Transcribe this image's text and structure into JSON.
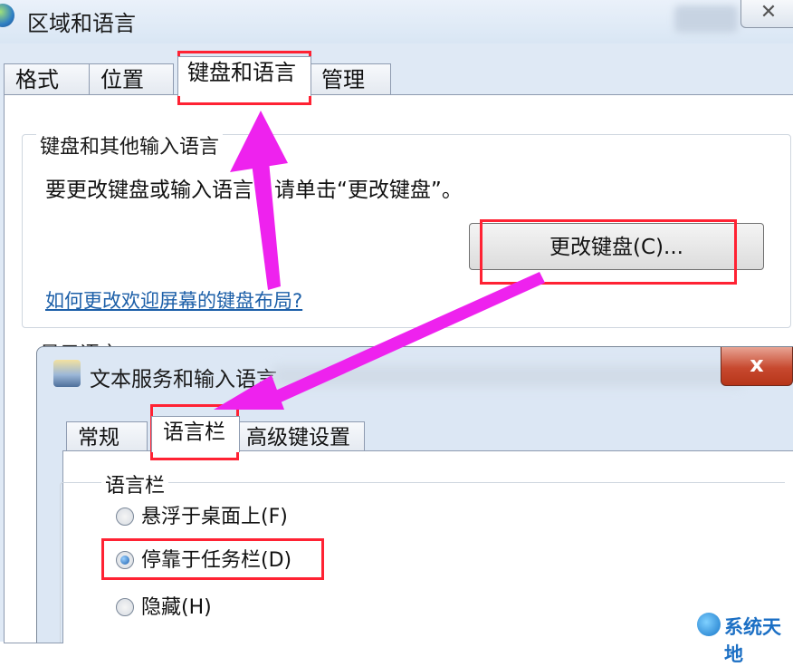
{
  "region_window": {
    "title": "区域和语言",
    "close_label": "✕",
    "tabs": [
      {
        "label": "格式"
      },
      {
        "label": "位置"
      },
      {
        "label": "键盘和语言"
      },
      {
        "label": "管理"
      }
    ],
    "active_tab": "键盘和语言",
    "keyboard_group": {
      "legend": "键盘和其他输入语言",
      "description": "要更改键盘或输入语言，请单击“更改键盘”。",
      "change_button_label": "更改键盘(C)...",
      "help_link": "如何更改欢迎屏幕的键盘布局?"
    },
    "display_language_legend": "显示语言"
  },
  "text_services_window": {
    "title": "文本服务和输入语言",
    "close_label": "x",
    "tabs": [
      {
        "label": "常规"
      },
      {
        "label": "语言栏"
      },
      {
        "label": "高级键设置"
      }
    ],
    "active_tab": "语言栏",
    "language_bar_group": {
      "legend": "语言栏",
      "options": [
        {
          "label": "悬浮于桌面上(F)",
          "selected": false
        },
        {
          "label": "停靠于任务栏(D)",
          "selected": true
        },
        {
          "label": "隐藏(H)",
          "selected": false
        }
      ]
    }
  },
  "annotations": {
    "highlight_color": "#ff2233",
    "arrow_color": "#ee22ee"
  },
  "watermark": {
    "text": "系统天地",
    "logo": "globe-logo-icon"
  }
}
